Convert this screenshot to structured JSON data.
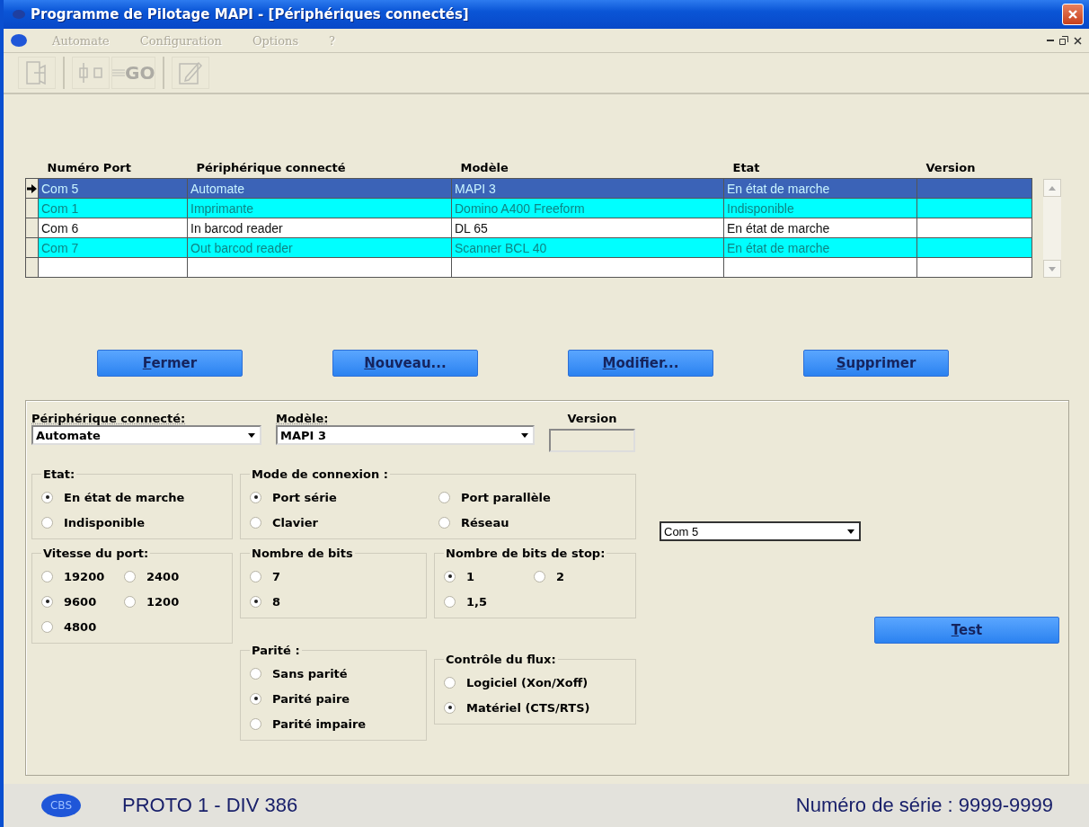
{
  "window": {
    "title": "Programme de Pilotage MAPI - [Périphériques connectés]"
  },
  "menu": [
    {
      "label": "Automate",
      "disabled": true
    },
    {
      "label": "Configuration",
      "disabled": true
    },
    {
      "label": "Options",
      "disabled": true
    },
    {
      "label": "?",
      "disabled": true
    }
  ],
  "toolbar": [
    {
      "kind": "exit",
      "disabled": true
    },
    {
      "kind": "io",
      "disabled": true
    },
    {
      "kind": "go",
      "label": "GO",
      "disabled": true
    },
    {
      "kind": "edit",
      "disabled": true
    }
  ],
  "table": {
    "columns": [
      "Numéro Port",
      "Périphérique connecté",
      "Modèle",
      "Etat",
      "Version"
    ],
    "rows": [
      {
        "cells": [
          "Com 5",
          "Automate",
          "MAPI 3",
          "En état de marche"
        ],
        "selected": true,
        "highlighted": false
      },
      {
        "cells": [
          "Com 1",
          "Imprimante",
          "Domino A400 Freeform",
          "Indisponible"
        ],
        "selected": false,
        "highlighted": true
      },
      {
        "cells": [
          "Com 6",
          "In barcod reader",
          "DL 65",
          "En état de marche"
        ],
        "selected": false,
        "highlighted": false
      },
      {
        "cells": [
          "Com 7",
          "Out barcod reader",
          "Scanner BCL 40",
          "En état de marche"
        ],
        "selected": false,
        "highlighted": true
      }
    ],
    "new_row": true
  },
  "actions": [
    "Fermer",
    "Nouveau...",
    "Modifier...",
    "Supprimer"
  ],
  "form": {
    "device": {
      "label": "Périphérique connecté:",
      "value": "Automate"
    },
    "model": {
      "label": "Modèle:",
      "value": "MAPI 3"
    },
    "version": {
      "label": "Version"
    },
    "etat": {
      "title": "Etat:",
      "options": [
        {
          "label": "En état de marche",
          "selected": true
        },
        {
          "label": "Indisponible",
          "selected": false
        }
      ]
    },
    "mode": {
      "title": "Mode de connexion :",
      "options": [
        {
          "label": "Port série",
          "selected": true
        },
        {
          "label": "Port parallèle",
          "selected": false
        },
        {
          "label": "Clavier",
          "selected": false
        },
        {
          "label": "Réseau",
          "selected": false
        }
      ]
    },
    "port": {
      "value": "Com 5"
    },
    "vitesse": {
      "title": "Vitesse du port:",
      "options": [
        {
          "label": "19200",
          "selected": false
        },
        {
          "label": "2400",
          "selected": false
        },
        {
          "label": "9600",
          "selected": true
        },
        {
          "label": "1200",
          "selected": false
        },
        {
          "label": "4800",
          "selected": false
        }
      ]
    },
    "bits": {
      "title": "Nombre de bits",
      "options": [
        {
          "label": "7",
          "selected": false
        },
        {
          "label": "8",
          "selected": true
        }
      ]
    },
    "stop": {
      "title": "Nombre de bits de stop:",
      "options": [
        {
          "label": "1",
          "selected": true
        },
        {
          "label": "2",
          "selected": false
        },
        {
          "label": "1,5",
          "selected": false
        }
      ]
    },
    "parite": {
      "title": "Parité :",
      "options": [
        {
          "label": "Sans parité",
          "selected": false
        },
        {
          "label": "Parité paire",
          "selected": true
        },
        {
          "label": "Parité impaire",
          "selected": false
        }
      ]
    },
    "flux": {
      "title": "Contrôle du flux:",
      "options": [
        {
          "label": "Logiciel (Xon/Xoff)",
          "selected": false
        },
        {
          "label": "Matériel (CTS/RTS)",
          "selected": true
        }
      ]
    },
    "test_button": "Test"
  },
  "status_bar": {
    "logo": "CBS",
    "left": "PROTO 1 - DIV 386",
    "right": "Numéro de série : 9999-9999"
  }
}
